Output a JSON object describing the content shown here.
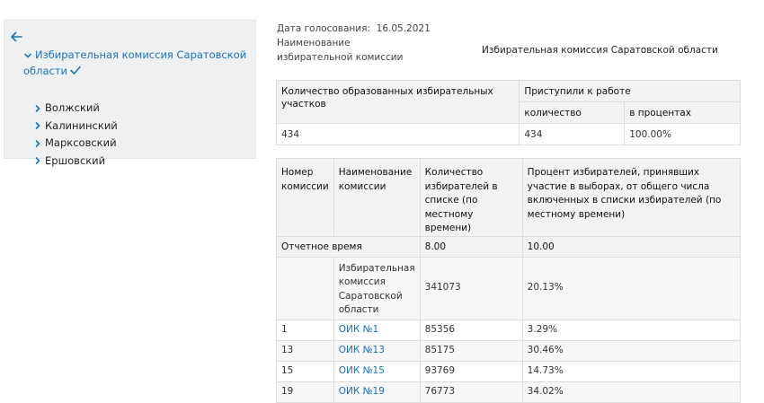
{
  "sidebar": {
    "root_label": "Избирательная комиссия Саратовской области",
    "children": [
      "Волжский",
      "Калининский",
      "Марксовский",
      "Ершовский"
    ]
  },
  "meta": {
    "date_label": "Дата голосования:",
    "date_value": "16.05.2021",
    "name_label": "Наименование избирательной комиссии",
    "name_value": "Избирательная комиссия Саратовской области"
  },
  "summary": {
    "col1_header": "Количество образованных избирательных участков",
    "col2_header": "Приступили к работе",
    "sub_count": "количество",
    "sub_percent": "в процентах",
    "total": "434",
    "count": "434",
    "percent": "100.00%"
  },
  "turnout": {
    "headers": [
      "Номер комиссии",
      "Наименование комиссии",
      "Количество избирателей в списке (по местному времени)",
      "Процент избирателей, принявших участие в выборах, от общего числа включенных в списки избирателей (по местному времени)"
    ],
    "report_time_label": "Отчетное время",
    "report_time_a": "8.00",
    "report_time_b": "10.00",
    "total_row": {
      "name": "Избирательная комиссия Саратовской области",
      "voters": "341073",
      "percent": "20.13%"
    },
    "rows": [
      {
        "num": "1",
        "name": "ОИК №1",
        "voters": "85356",
        "percent": "3.29%"
      },
      {
        "num": "13",
        "name": "ОИК №13",
        "voters": "85175",
        "percent": "30.46%"
      },
      {
        "num": "15",
        "name": "ОИК №15",
        "voters": "93769",
        "percent": "14.73%"
      },
      {
        "num": "19",
        "name": "ОИК №19",
        "voters": "76773",
        "percent": "34.02%"
      }
    ]
  },
  "colors": {
    "link": "#1a73b5",
    "sidebar_bg": "#eef0f2",
    "header_bg": "#f2f2f2"
  },
  "icons": {
    "back": "arrow-left-icon",
    "expand": "chevron-down-icon",
    "collapsed": "chevron-right-icon",
    "selected": "checkmark-icon"
  }
}
